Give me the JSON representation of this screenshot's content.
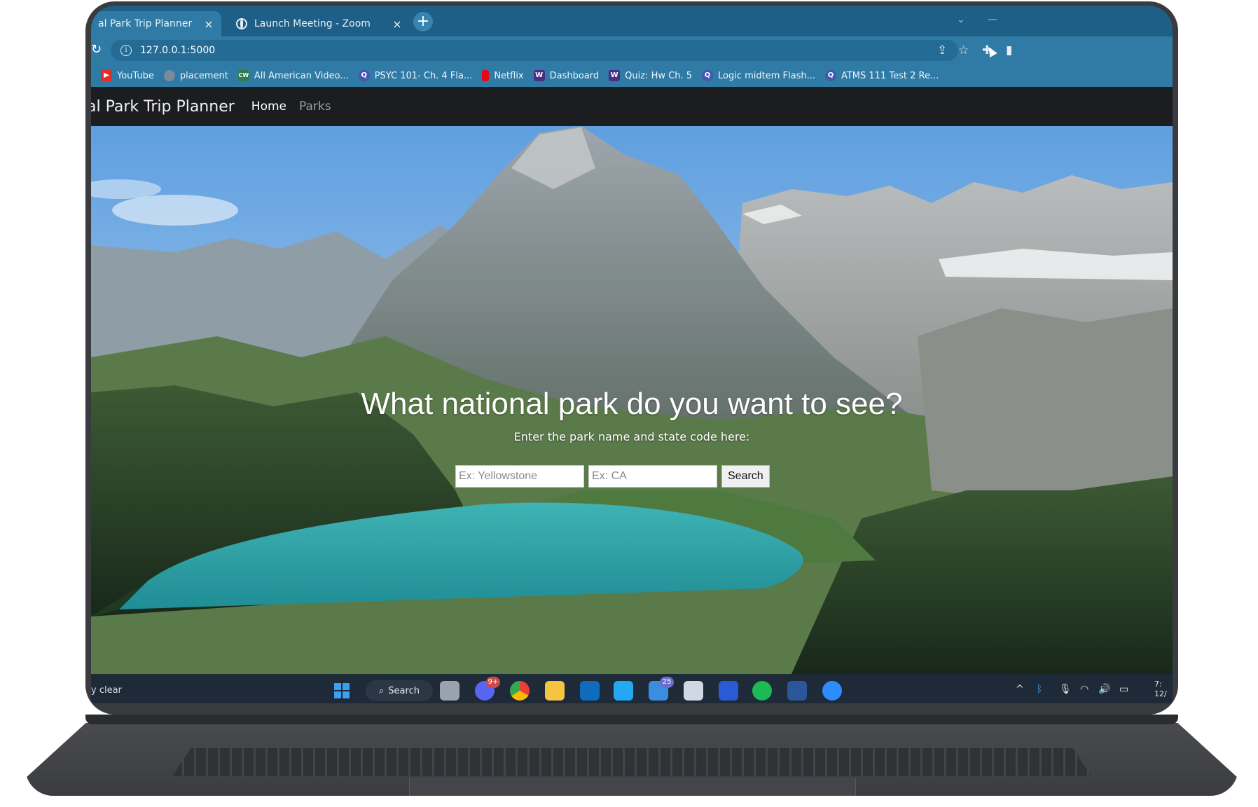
{
  "browser": {
    "tabs": [
      {
        "title": "al Park Trip Planner",
        "active": true
      },
      {
        "title": "Launch Meeting - Zoom",
        "active": false
      }
    ],
    "close_glyph": "×",
    "new_tab_glyph": "+",
    "url": "127.0.0.1:5000",
    "bookmarks": [
      {
        "label": "YouTube",
        "icon": "youtube-icon",
        "color": "#e52d27"
      },
      {
        "label": "placement",
        "icon": "globe-icon",
        "color": "#7a8a99"
      },
      {
        "label": "All American Video...",
        "icon": "cw-icon",
        "color": "#2e7d4f"
      },
      {
        "label": "PSYC 101- Ch. 4 Fla...",
        "icon": "quizlet-icon",
        "color": "#4257b2"
      },
      {
        "label": "Netflix",
        "icon": "netflix-icon",
        "color": "#e50914"
      },
      {
        "label": "Dashboard",
        "icon": "canvas-w-icon",
        "color": "#4b2e83"
      },
      {
        "label": "Quiz: Hw Ch. 5",
        "icon": "canvas-w-icon",
        "color": "#4b2e83"
      },
      {
        "label": "Logic midtem Flash...",
        "icon": "quizlet-icon",
        "color": "#4257b2"
      },
      {
        "label": "ATMS 111 Test 2 Re...",
        "icon": "quizlet-icon",
        "color": "#4257b2"
      }
    ]
  },
  "site": {
    "brand": "al Park Trip Planner",
    "nav": {
      "home": "Home",
      "parks": "Parks"
    },
    "hero": {
      "headline": "What national park do you want to see?",
      "subline": "Enter the park name and state code here:",
      "park_placeholder": "Ex: Yellowstone",
      "state_placeholder": "Ex: CA",
      "search_label": "Search"
    }
  },
  "taskbar": {
    "weather": "y clear",
    "search_label": "Search",
    "discord_badge": "9+",
    "mail_badge": "25",
    "clock_time": "7:",
    "clock_date": "12/"
  },
  "colors": {
    "tabstrip": "#1d5f86",
    "toolbar": "#2f7ba6",
    "navbar": "#1b1d20",
    "taskbar": "#1f2a38"
  }
}
